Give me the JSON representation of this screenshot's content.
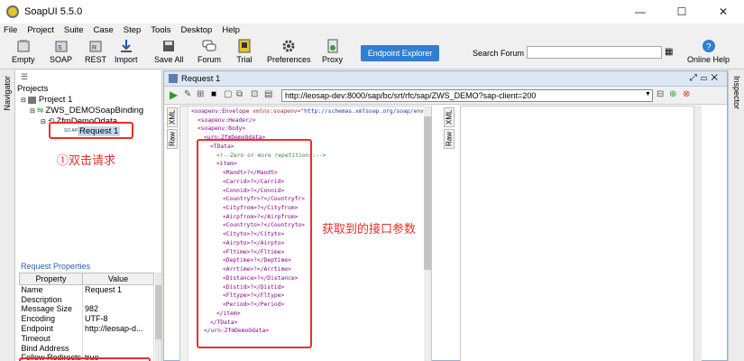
{
  "window": {
    "title": "SoapUI 5.5.0",
    "minimize": "—",
    "maximize": "☐",
    "close": "✕"
  },
  "menu": [
    "File",
    "Project",
    "Suite",
    "Case",
    "Step",
    "Tools",
    "Desktop",
    "Help"
  ],
  "toolbar": {
    "empty": "Empty",
    "soap": "SOAP",
    "rest": "REST",
    "import": "Import",
    "save_all": "Save All",
    "forum": "Forum",
    "trial": "Trial",
    "preferences": "Preferences",
    "proxy": "Proxy",
    "endpoint_explorer": "Endpoint Explorer",
    "search_forum": "Search Forum",
    "online_help": "Online Help"
  },
  "side": {
    "navigator": "Navigator",
    "inspector": "Inspector"
  },
  "tree": {
    "root": "Projects",
    "project": "Project 1",
    "binding": "ZWS_DEMOSoapBinding",
    "operation": "ZfmDemoOdata",
    "request": "Request 1",
    "soap_badge": "SO AP"
  },
  "properties": {
    "title": "Request Properties",
    "col_property": "Property",
    "col_value": "Value",
    "rows": [
      {
        "name": "Name",
        "value": "Request 1"
      },
      {
        "name": "Description",
        "value": ""
      },
      {
        "name": "Message Size",
        "value": "982"
      },
      {
        "name": "Encoding",
        "value": "UTF-8"
      },
      {
        "name": "Endpoint",
        "value": "http://leosap-d..."
      },
      {
        "name": "Timeout",
        "value": ""
      },
      {
        "name": "Bind Address",
        "value": ""
      },
      {
        "name": "Follow Redirects",
        "value": "true"
      }
    ]
  },
  "request": {
    "title": "Request 1",
    "url": "http://leosap-dev:8000/sap/bc/srt/rfc/sap/ZWS_DEMO?sap-client=200",
    "tab_xml": "XML",
    "tab_raw": "Raw",
    "xml_lines": [
      {
        "p": "<",
        "tag": "soapenv:Envelope",
        "attr": " xmlns:soapenv=",
        "val": "\"http://schemas.xmlsoap.org/soap/envelope",
        "s": ""
      },
      {
        "p": "<",
        "tag": "soapenv:Header",
        "attr": "",
        "val": "",
        "s": "/>"
      },
      {
        "p": "<",
        "tag": "soapenv:Body",
        "attr": "",
        "val": "",
        "s": ">"
      },
      {
        "p": "<",
        "tag": "urn:ZfmDemoOdata",
        "attr": "",
        "val": "",
        "s": ">"
      },
      {
        "p": "<",
        "tag": "TData",
        "attr": "",
        "val": "",
        "s": ">"
      },
      {
        "p": "",
        "tag": "",
        "attr": "",
        "val": "",
        "s": "",
        "c": "<!--Zero or more repetitions:-->"
      },
      {
        "p": "<",
        "tag": "item",
        "attr": "",
        "val": "",
        "s": ">"
      },
      {
        "p": "<",
        "tag": "Mandt",
        "attr": "",
        "val": "",
        "s": ">?</Mandt>"
      },
      {
        "p": "<",
        "tag": "Carrid",
        "attr": "",
        "val": "",
        "s": ">?</Carrid>"
      },
      {
        "p": "<",
        "tag": "Connid",
        "attr": "",
        "val": "",
        "s": ">?</Connid>"
      },
      {
        "p": "<",
        "tag": "Countryfr",
        "attr": "",
        "val": "",
        "s": ">?</Countryfr>"
      },
      {
        "p": "<",
        "tag": "Cityfrom",
        "attr": "",
        "val": "",
        "s": ">?</Cityfrom>"
      },
      {
        "p": "<",
        "tag": "Airpfrom",
        "attr": "",
        "val": "",
        "s": ">?</Airpfrom>"
      },
      {
        "p": "<",
        "tag": "Countryto",
        "attr": "",
        "val": "",
        "s": ">?</Countryto>"
      },
      {
        "p": "<",
        "tag": "Cityto",
        "attr": "",
        "val": "",
        "s": ">?</Cityto>"
      },
      {
        "p": "<",
        "tag": "Airpto",
        "attr": "",
        "val": "",
        "s": ">?</Airpto>"
      },
      {
        "p": "<",
        "tag": "Fltime",
        "attr": "",
        "val": "",
        "s": ">?</Fltime>"
      },
      {
        "p": "<",
        "tag": "Deptime",
        "attr": "",
        "val": "",
        "s": ">?</Deptime>"
      },
      {
        "p": "<",
        "tag": "Arrtime",
        "attr": "",
        "val": "",
        "s": ">?</Arrtime>"
      },
      {
        "p": "<",
        "tag": "Distance",
        "attr": "",
        "val": "",
        "s": ">?</Distance>"
      },
      {
        "p": "<",
        "tag": "Distid",
        "attr": "",
        "val": "",
        "s": ">?</Distid>"
      },
      {
        "p": "<",
        "tag": "Fltype",
        "attr": "",
        "val": "",
        "s": ">?</Fltype>"
      },
      {
        "p": "<",
        "tag": "Period",
        "attr": "",
        "val": "",
        "s": ">?</Period>"
      },
      {
        "p": "</",
        "tag": "item",
        "attr": "",
        "val": "",
        "s": ">"
      },
      {
        "p": "</",
        "tag": "TData",
        "attr": "",
        "val": "",
        "s": ">"
      },
      {
        "p": "</",
        "tag": "urn:ZfmDemoOdata",
        "attr": "",
        "val": "",
        "s": ">"
      }
    ]
  },
  "annotations": {
    "double_click": "①双击请求",
    "params": "获取到的接口参数"
  },
  "colors": {
    "accent": "#2f7fd2",
    "annotation": "#e8302a",
    "tag": "#8b008b"
  }
}
